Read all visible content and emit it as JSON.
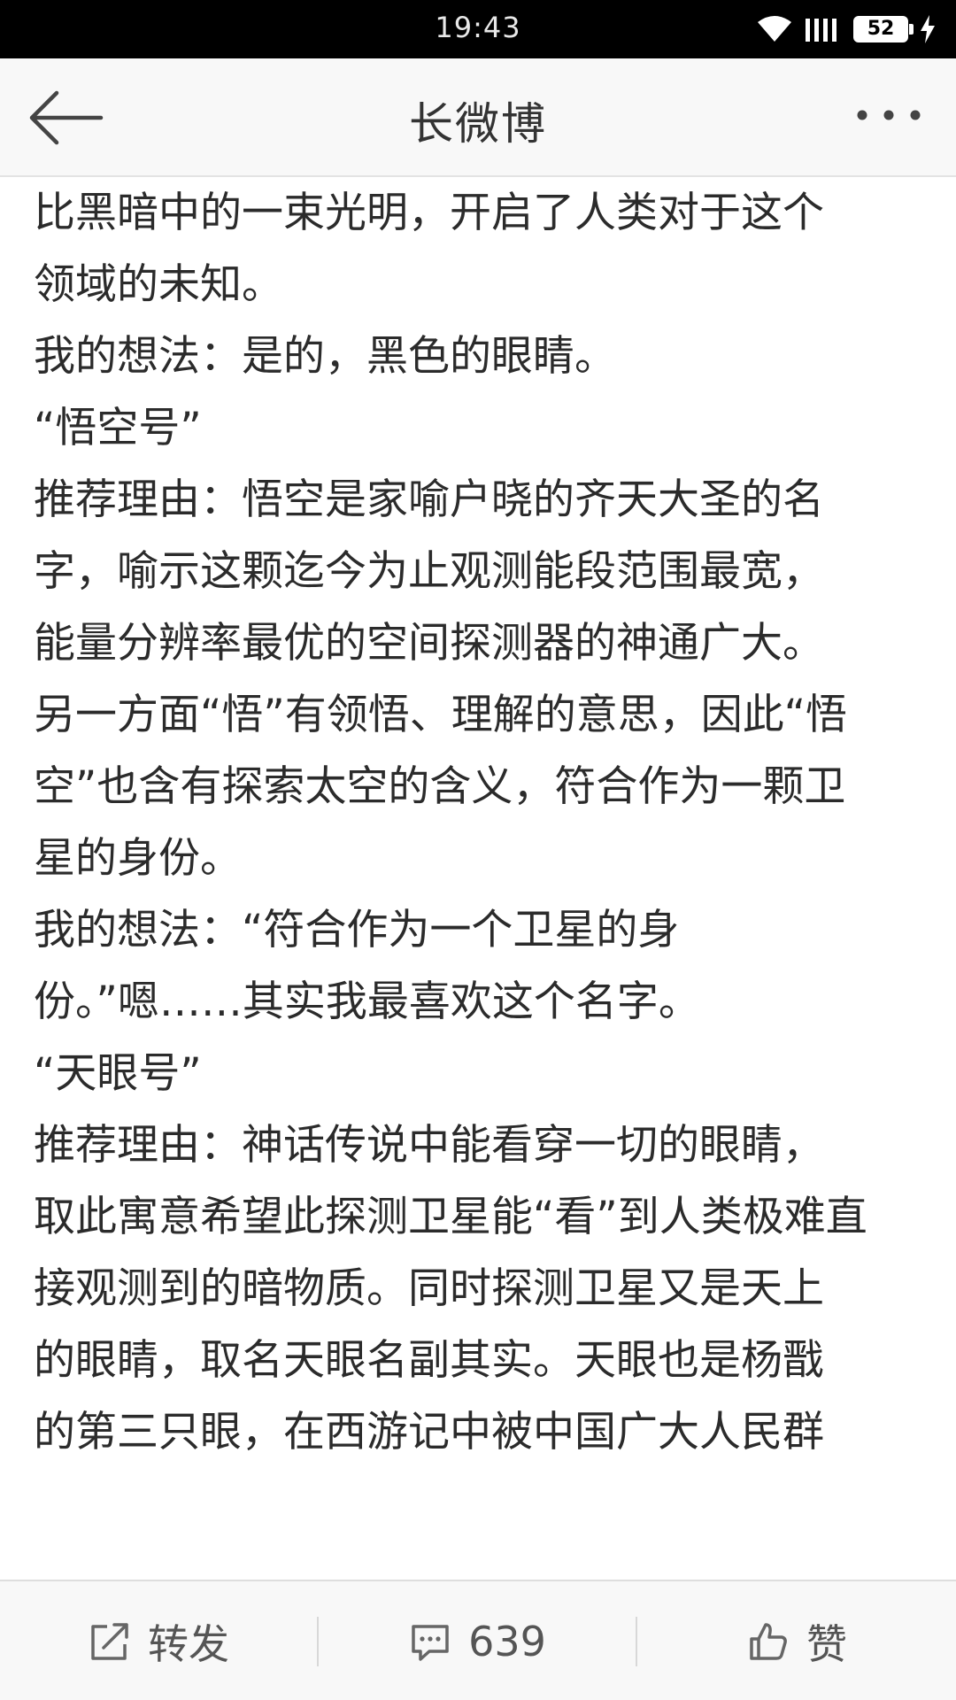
{
  "status_bar": {
    "time": "19:43",
    "battery": "52"
  },
  "nav": {
    "title": "长微博"
  },
  "article": {
    "lines": [
      "比黑暗中的一束光明，开启了人类对于这个",
      "领域的未知。",
      "我的想法：是的，黑色的眼睛。",
      "",
      "“悟空号”",
      "推荐理由：悟空是家喻户晓的齐天大圣的名",
      "字，喻示这颗迄今为止观测能段范围最宽，",
      "能量分辨率最优的空间探测器的神通广大。",
      "另一方面“悟”有领悟、理解的意思，因此“悟",
      "空”也含有探索太空的含义，符合作为一颗卫",
      "星的身份。",
      "我的想法：“符合作为一个卫星的身",
      "份。”嗯……其实我最喜欢这个名字。",
      "",
      "“天眼号”",
      "推荐理由：神话传说中能看穿一切的眼睛，",
      "取此寓意希望此探测卫星能“看”到人类极难直",
      "接观测到的暗物质。同时探测卫星又是天上",
      "的眼睛，取名天眼名副其实。天眼也是杨戬",
      "的第三只眼，在西游记中被中国广大人民群"
    ]
  },
  "bottom_bar": {
    "repost_label": "转发",
    "comment_count": "639",
    "like_label": "赞"
  }
}
